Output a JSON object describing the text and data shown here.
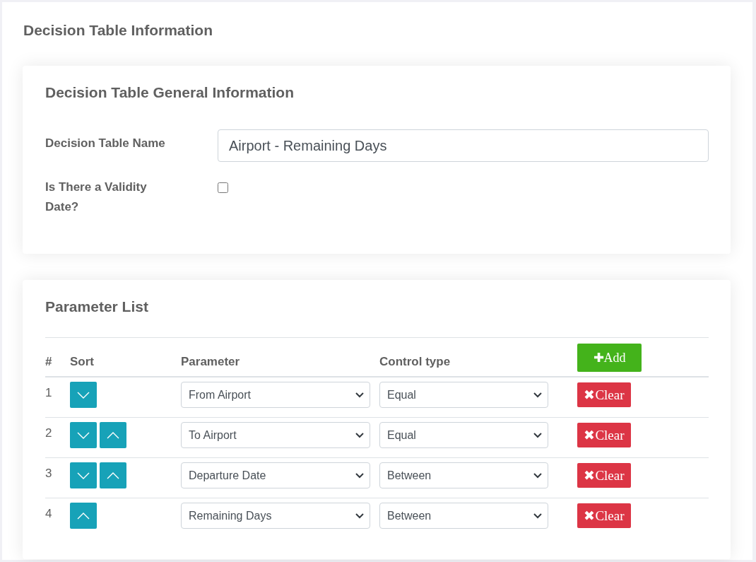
{
  "page": {
    "title": "Decision Table Information"
  },
  "general": {
    "title": "Decision Table General Information",
    "name_field": {
      "label": "Decision Table Name",
      "value": "Airport - Remaining Days"
    },
    "validity": {
      "label": "Is There a Validity Date?",
      "checked": false
    }
  },
  "parameters": {
    "title": "Parameter List",
    "columns": [
      "#",
      "Sort",
      "Parameter",
      "Control type"
    ],
    "add_button": {
      "icon": "✚",
      "label": "Add"
    },
    "rows": [
      {
        "index": "1",
        "sort": [
          {
            "kind": "down"
          }
        ],
        "parameter": "From Airport",
        "control_type": "Equal",
        "clear": {
          "icon": "✖",
          "label": "Clear"
        }
      },
      {
        "index": "2",
        "sort": [
          {
            "kind": "down"
          },
          {
            "kind": "up"
          }
        ],
        "parameter": "To Airport",
        "control_type": "Equal",
        "clear": {
          "icon": "✖",
          "label": "Clear"
        }
      },
      {
        "index": "3",
        "sort": [
          {
            "kind": "down"
          },
          {
            "kind": "up"
          }
        ],
        "parameter": "Departure Date",
        "control_type": "Between",
        "clear": {
          "icon": "✖",
          "label": "Clear"
        }
      },
      {
        "index": "4",
        "sort": [
          {
            "kind": "up"
          }
        ],
        "parameter": "Remaining Days",
        "control_type": "Between",
        "clear": {
          "icon": "✖",
          "label": "Clear"
        }
      }
    ]
  }
}
